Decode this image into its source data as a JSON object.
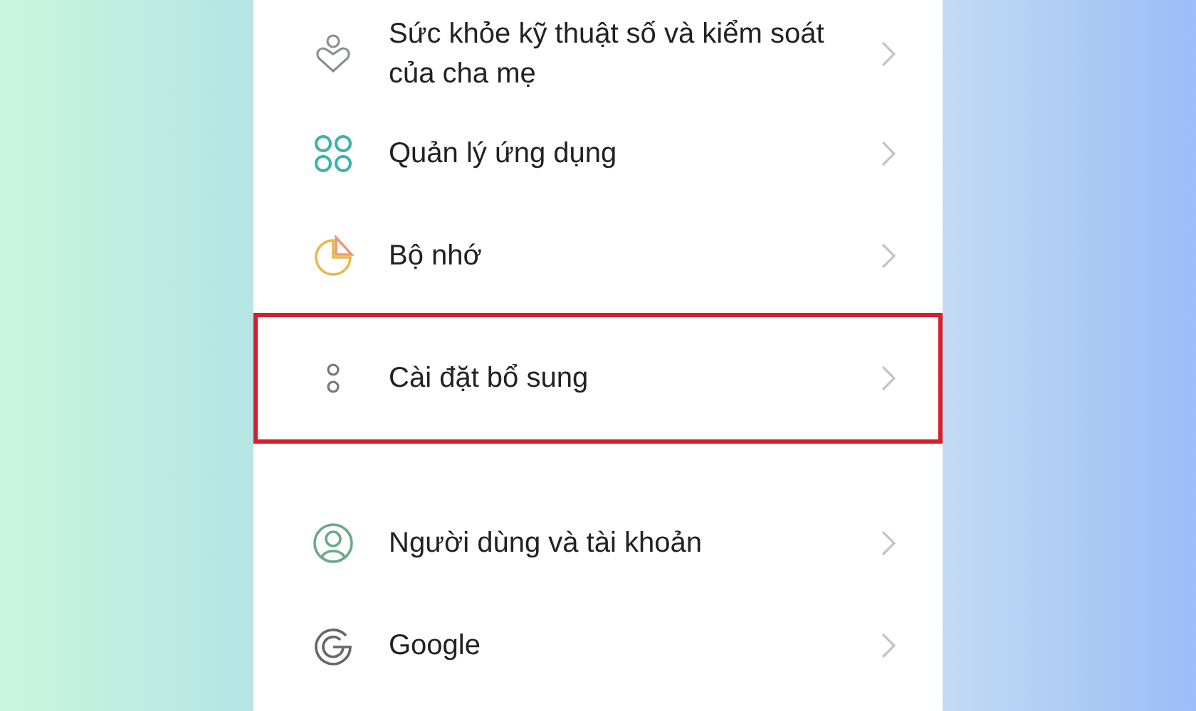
{
  "groups": [
    {
      "items": [
        {
          "label": "Sức khỏe kỹ thuật số và kiểm soát của cha mẹ",
          "highlighted": false
        },
        {
          "label": "Quản lý ứng dụng",
          "highlighted": false
        },
        {
          "label": "Bộ nhớ",
          "highlighted": false
        },
        {
          "label": "Cài đặt bổ sung",
          "highlighted": true
        }
      ]
    },
    {
      "items": [
        {
          "label": "Người dùng và tài khoản",
          "highlighted": false
        },
        {
          "label": "Google",
          "highlighted": false
        }
      ]
    }
  ]
}
